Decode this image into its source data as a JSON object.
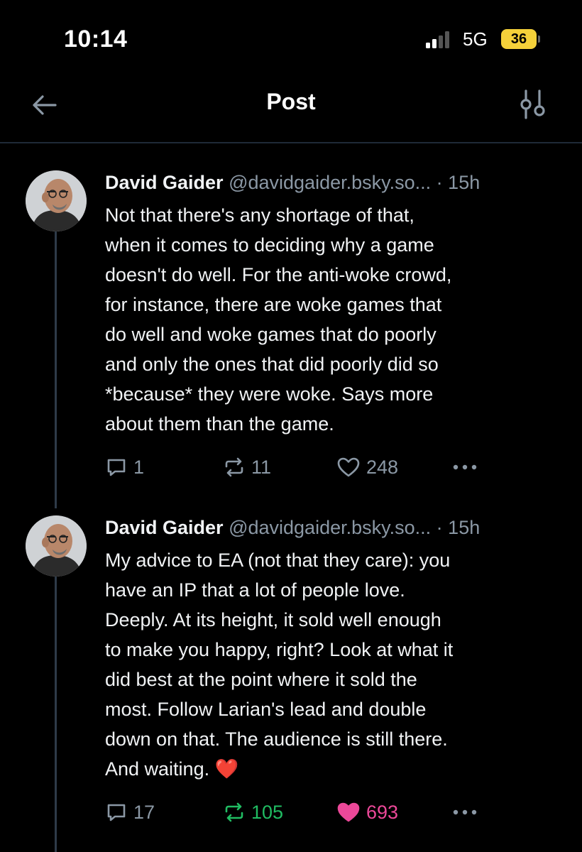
{
  "status_bar": {
    "time": "10:14",
    "network": "5G",
    "battery": "36"
  },
  "header": {
    "title": "Post"
  },
  "posts": [
    {
      "author": "David Gaider",
      "handle": "@davidgaider.bsky.so...",
      "separator": "·",
      "age": "15h",
      "text": "Not that there's any shortage of that,\nwhen it comes to deciding why a game\ndoesn't do well. For the anti-woke crowd,\nfor instance, there are woke games that\ndo well and woke games that do poorly\nand only the ones that did poorly did so\n*because* they were woke. Says more\nabout them than the game.",
      "replies": "1",
      "reposts": "11",
      "likes": "248",
      "reposted": false,
      "liked": false
    },
    {
      "author": "David Gaider",
      "handle": "@davidgaider.bsky.so...",
      "separator": "·",
      "age": "15h",
      "text": "My advice to EA (not that they care): you\nhave an IP that a lot of people love.\nDeeply. At its height, it sold well enough\nto make you happy, right? Look at what it\ndid best at the point where it sold the\nmost. Follow Larian's lead and double\ndown on that. The audience is still there.\nAnd waiting. ❤️",
      "replies": "17",
      "reposts": "105",
      "likes": "693",
      "reposted": true,
      "liked": true
    }
  ],
  "colors": {
    "background": "#000000",
    "text": "#f1f3f5",
    "muted": "#8b98a5",
    "repost_active": "#20bc62",
    "like_active": "#ec4899",
    "battery": "#f5d13a",
    "divider": "#1f2a37"
  }
}
